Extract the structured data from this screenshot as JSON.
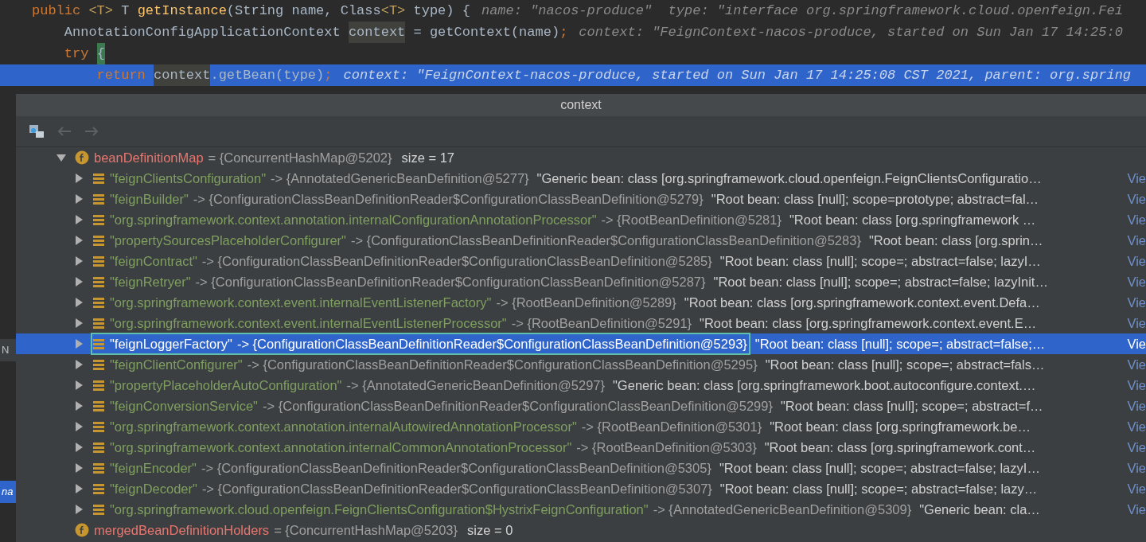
{
  "editor": {
    "lines": [
      {
        "selected": false,
        "tokens": [
          {
            "kind": "keyword",
            "text": "public "
          },
          {
            "kind": "typeparam",
            "text": "<T>"
          },
          {
            "kind": "plain",
            "text": " T "
          },
          {
            "kind": "method",
            "text": "getInstance"
          },
          {
            "kind": "plain",
            "text": "(String name, Class"
          },
          {
            "kind": "typeparam",
            "text": "<T>"
          },
          {
            "kind": "plain",
            "text": " type) {"
          },
          {
            "kind": "hint",
            "text": "name: \"nacos-produce\"  type: \"interface org.springframework.cloud.openfeign.Fei"
          }
        ]
      },
      {
        "selected": false,
        "tokens": [
          {
            "kind": "plain",
            "text": "    AnnotationConfigApplicationContext "
          },
          {
            "kind": "usage",
            "text": "context"
          },
          {
            "kind": "plain",
            "text": " = getContext(name)"
          },
          {
            "kind": "keyword",
            "text": ";"
          },
          {
            "kind": "hint",
            "text": "context: \"FeignContext-nacos-produce, started on Sun Jan 17 14:25:0"
          }
        ]
      },
      {
        "selected": false,
        "tokens": [
          {
            "kind": "keyword",
            "text": "    try "
          },
          {
            "kind": "brace-match",
            "text": "{"
          }
        ]
      },
      {
        "selected": true,
        "tokens": [
          {
            "kind": "keyword",
            "text": "        return "
          },
          {
            "kind": "usage",
            "text": "context"
          },
          {
            "kind": "plain",
            "text": ".getBean(type)"
          },
          {
            "kind": "keyword",
            "text": ";"
          },
          {
            "kind": "hint",
            "text": "context: \"FeignContext-nacos-produce, started on Sun Jan 17 14:25:08 CST 2021, parent: org.spring"
          }
        ]
      }
    ]
  },
  "side_strip": [
    {
      "text": "N",
      "selected": false
    },
    {
      "text": "na",
      "selected": true
    }
  ],
  "popup": {
    "title": "context",
    "tree": [
      {
        "name": "beanDefinitionMap",
        "value": "= {ConcurrentHashMap@5202}",
        "extra": "size = 17",
        "expanded": true,
        "children": [
          {
            "key": "\"feignClientsConfiguration\"",
            "value": "-> {AnnotatedGenericBeanDefinition@5277}",
            "description": "\"Generic bean: class [org.springframework.cloud.openfeign.FeignClientsConfiguratio…",
            "link": "Vie",
            "selected": false,
            "marked": false,
            "expanded": false
          },
          {
            "key": "\"feignBuilder\"",
            "value": "-> {ConfigurationClassBeanDefinitionReader$ConfigurationClassBeanDefinition@5279}",
            "description": "\"Root bean: class [null]; scope=prototype; abstract=fal…",
            "link": "Vie",
            "selected": false,
            "marked": false,
            "expanded": false
          },
          {
            "key": "\"org.springframework.context.annotation.internalConfigurationAnnotationProcessor\"",
            "value": "-> {RootBeanDefinition@5281}",
            "description": "\"Root bean: class [org.springframework …",
            "link": "Vie",
            "selected": false,
            "marked": false,
            "expanded": false
          },
          {
            "key": "\"propertySourcesPlaceholderConfigurer\"",
            "value": "-> {ConfigurationClassBeanDefinitionReader$ConfigurationClassBeanDefinition@5283}",
            "description": "\"Root bean: class [org.sprin…",
            "link": "Vie",
            "selected": false,
            "marked": false,
            "expanded": false
          },
          {
            "key": "\"feignContract\"",
            "value": "-> {ConfigurationClassBeanDefinitionReader$ConfigurationClassBeanDefinition@5285}",
            "description": "\"Root bean: class [null]; scope=; abstract=false; lazyI…",
            "link": "Vie",
            "selected": false,
            "marked": false,
            "expanded": false
          },
          {
            "key": "\"feignRetryer\"",
            "value": "-> {ConfigurationClassBeanDefinitionReader$ConfigurationClassBeanDefinition@5287}",
            "description": "\"Root bean: class [null]; scope=; abstract=false; lazyInit…",
            "link": "Vie",
            "selected": false,
            "marked": false,
            "expanded": false
          },
          {
            "key": "\"org.springframework.context.event.internalEventListenerFactory\"",
            "value": "-> {RootBeanDefinition@5289}",
            "description": "\"Root bean: class [org.springframework.context.event.Defa…",
            "link": "Vie",
            "selected": false,
            "marked": false,
            "expanded": false
          },
          {
            "key": "\"org.springframework.context.event.internalEventListenerProcessor\"",
            "value": "-> {RootBeanDefinition@5291}",
            "description": "\"Root bean: class [org.springframework.context.event.E…",
            "link": "Vie",
            "selected": false,
            "marked": false,
            "expanded": false
          },
          {
            "key": "\"feignLoggerFactory\"",
            "value": "-> {ConfigurationClassBeanDefinitionReader$ConfigurationClassBeanDefinition@5293}",
            "description": "\"Root bean: class [null]; scope=; abstract=false;…",
            "link": "Vie",
            "selected": true,
            "marked": true,
            "expanded": false
          },
          {
            "key": "\"feignClientConfigurer\"",
            "value": "-> {ConfigurationClassBeanDefinitionReader$ConfigurationClassBeanDefinition@5295}",
            "description": "\"Root bean: class [null]; scope=; abstract=fals…",
            "link": "Vie",
            "selected": false,
            "marked": false,
            "expanded": false
          },
          {
            "key": "\"propertyPlaceholderAutoConfiguration\"",
            "value": "-> {AnnotatedGenericBeanDefinition@5297}",
            "description": "\"Generic bean: class [org.springframework.boot.autoconfigure.context.…",
            "link": "Vie",
            "selected": false,
            "marked": false,
            "expanded": false
          },
          {
            "key": "\"feignConversionService\"",
            "value": "-> {ConfigurationClassBeanDefinitionReader$ConfigurationClassBeanDefinition@5299}",
            "description": "\"Root bean: class [null]; scope=; abstract=f…",
            "link": "Vie",
            "selected": false,
            "marked": false,
            "expanded": false
          },
          {
            "key": "\"org.springframework.context.annotation.internalAutowiredAnnotationProcessor\"",
            "value": "-> {RootBeanDefinition@5301}",
            "description": "\"Root bean: class [org.springframework.be…",
            "link": "Vie",
            "selected": false,
            "marked": false,
            "expanded": false
          },
          {
            "key": "\"org.springframework.context.annotation.internalCommonAnnotationProcessor\"",
            "value": "-> {RootBeanDefinition@5303}",
            "description": "\"Root bean: class [org.springframework.cont…",
            "link": "Vie",
            "selected": false,
            "marked": false,
            "expanded": false
          },
          {
            "key": "\"feignEncoder\"",
            "value": "-> {ConfigurationClassBeanDefinitionReader$ConfigurationClassBeanDefinition@5305}",
            "description": "\"Root bean: class [null]; scope=; abstract=false; lazyI…",
            "link": "Vie",
            "selected": false,
            "marked": false,
            "expanded": false
          },
          {
            "key": "\"feignDecoder\"",
            "value": "-> {ConfigurationClassBeanDefinitionReader$ConfigurationClassBeanDefinition@5307}",
            "description": "\"Root bean: class [null]; scope=; abstract=false; lazy…",
            "link": "Vie",
            "selected": false,
            "marked": false,
            "expanded": false
          },
          {
            "key": "\"org.springframework.cloud.openfeign.FeignClientsConfiguration$HystrixFeignConfiguration\"",
            "value": "-> {AnnotatedGenericBeanDefinition@5309}",
            "description": "\"Generic bean: cla…",
            "link": "Vie",
            "selected": false,
            "marked": false,
            "expanded": false
          }
        ]
      },
      {
        "name": "mergedBeanDefinitionHolders",
        "value": "= {ConcurrentHashMap@5203}",
        "extra": "size = 0"
      }
    ]
  }
}
